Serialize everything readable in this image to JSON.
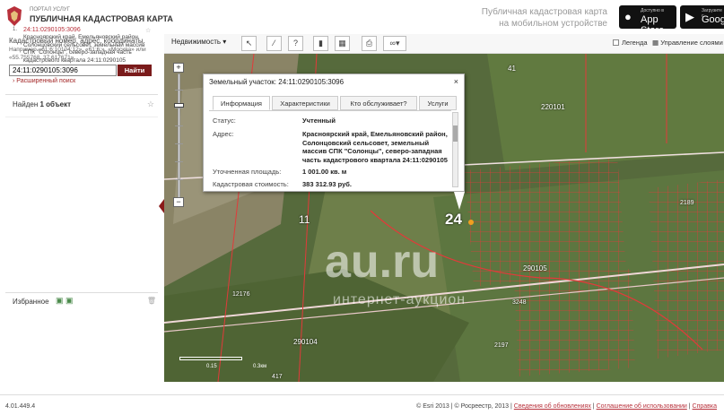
{
  "header": {
    "portal_small": "ПОРТАЛ УСЛУГ",
    "portal_title": "ПУБЛИЧНАЯ КАДАСТРОВАЯ КАРТА",
    "mobile_line1": "Публичная кадастровая карта",
    "mobile_line2": "на мобильном устройстве",
    "appstore_small": "Доступно в",
    "appstore_big": "App Store",
    "google_small": "Загрузите с",
    "google_big": "Google"
  },
  "search": {
    "hint": "Кадастровый номер, адрес, координаты.",
    "example": "Например «61:6:10104:12», «61:6:», «Москва» или «55.755768, 37.617671»",
    "value": "24:11:0290105:3096",
    "button": "Найти",
    "advanced": "Расширенный поиск"
  },
  "results": {
    "found_prefix": "Найден ",
    "found_bold": "1 объект",
    "item_num": "1.",
    "item_link": "24:11:0290105:3096",
    "item_desc": "Красноярский край, Емельяновский район, Солонцовский сельсовет, земельный массив СПК \"Солонцы\", северо-западная часть кадастрового квартала 24:11:0290105"
  },
  "favorites": {
    "label": "Избранное"
  },
  "toolbar": {
    "select_label": "Недвижимость",
    "legend": "Легенда",
    "layers": "Управление слоями"
  },
  "popup": {
    "title": "Земельный участок: 24:11:0290105:3096",
    "tabs": [
      "Информация",
      "Характеристики",
      "Кто обслуживает?",
      "Услуги"
    ],
    "rows": [
      {
        "label": "Статус:",
        "value": "Учтенный"
      },
      {
        "label": "Адрес:",
        "value": "Красноярский край, Емельяновский район, Солонцовский сельсовет, земельный массив СПК \"Солонцы\", северо-западная часть кадастрового квартала 24:11:0290105"
      },
      {
        "label": "Уточненная площадь:",
        "value": "1 001.00 кв. м"
      },
      {
        "label": "Кадастровая стоимость:",
        "value": "383 312.93 руб."
      }
    ]
  },
  "map": {
    "labels": {
      "l41": "41",
      "l220101": "220101",
      "l11": "11",
      "l24": "24",
      "l290105": "290105",
      "l12176": "12176",
      "l290104": "290104",
      "l2189": "2189",
      "l3248": "3248",
      "l2197": "2197",
      "l417": "417"
    },
    "watermark": "au.ru",
    "watermark_sub": "интернет-аукцион",
    "scale_a": "0.15",
    "scale_b": "0.3км"
  },
  "footer": {
    "version": "4.01.449.4",
    "copy": "© Esri 2013 | © Росреестр, 2013 |",
    "link1": "Сведения об обновлениях",
    "sep": "|",
    "link2": "Соглашение об использовании",
    "sep2": "|",
    "link3": "Справка"
  },
  "colors": {
    "accent": "#7a1b1b",
    "link": "#b8313b",
    "parcel": "#e23a3a"
  }
}
